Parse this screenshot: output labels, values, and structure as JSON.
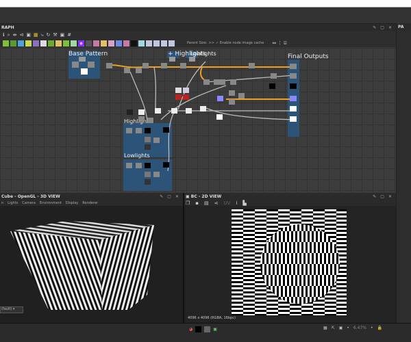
{
  "graph": {
    "title": "RAPH",
    "toolbar_icons": [
      "info-icon",
      "search-icon",
      "align-icon",
      "share-icon",
      "frame-icon",
      "grid-icon",
      "path-icon",
      "refresh-icon",
      "wrench-icon",
      "image-icon",
      "hash-icon"
    ],
    "parent_size_label": "Parent Size:",
    "more_label": ">>",
    "cache_label": "Enable node image cache",
    "frames": {
      "base": "Base Pattern",
      "highlights_top": "+ Highlights",
      "lowlights_top": "Lowlights",
      "outputs": "Final Outputs",
      "highlights": "Highlights",
      "lowlights": "Lowlights"
    },
    "node_colors": [
      "#7cbf3a",
      "#c8d94e",
      "#8a6fc6",
      "#e0c068",
      "#c47aa6",
      "#d9a0c9",
      "#4f9fd9",
      "#a0d8e0"
    ]
  },
  "right_panel": {
    "title": "PA"
  },
  "view3d": {
    "title": "Cube - OpenGL - 3D VIEW",
    "menu": [
      "n",
      "Lights",
      "Camera",
      "Environment",
      "Display",
      "Renderer"
    ],
    "dropdown": "(fault)"
  },
  "view2d": {
    "title": "BC - 2D VIEW",
    "info": "4096 x 4096 (RGBA, 16bpc)",
    "zoom": "6.47%"
  },
  "colors": {
    "accent": "#f0a020",
    "frame": "#2c5378"
  }
}
